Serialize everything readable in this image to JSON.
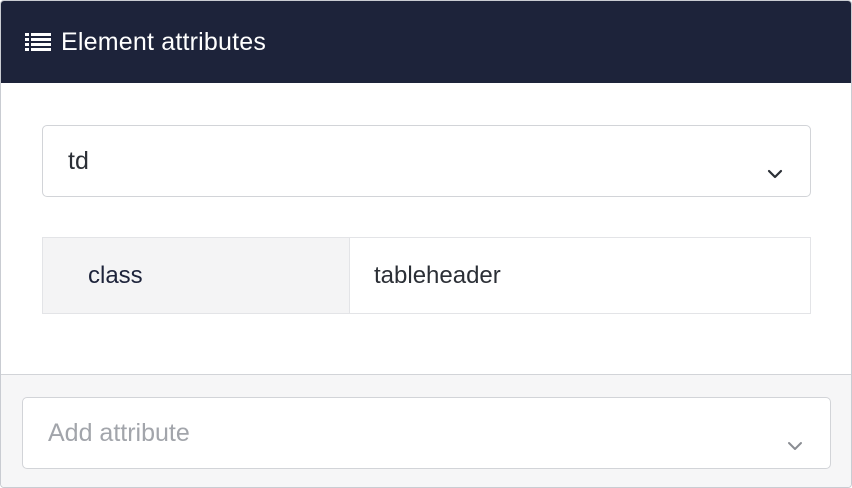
{
  "header": {
    "title": "Element attributes",
    "icon": "list-icon"
  },
  "element_select": {
    "value": "td",
    "icon": "chevron-down-icon"
  },
  "attributes": [
    {
      "name": "class",
      "value": "tableheader"
    }
  ],
  "add_attribute": {
    "placeholder": "Add attribute",
    "icon": "chevron-down-icon"
  },
  "colors": {
    "header_bg": "#1d233a",
    "attr_name_text": "#1d233a",
    "placeholder_text": "#a2a5ab"
  }
}
